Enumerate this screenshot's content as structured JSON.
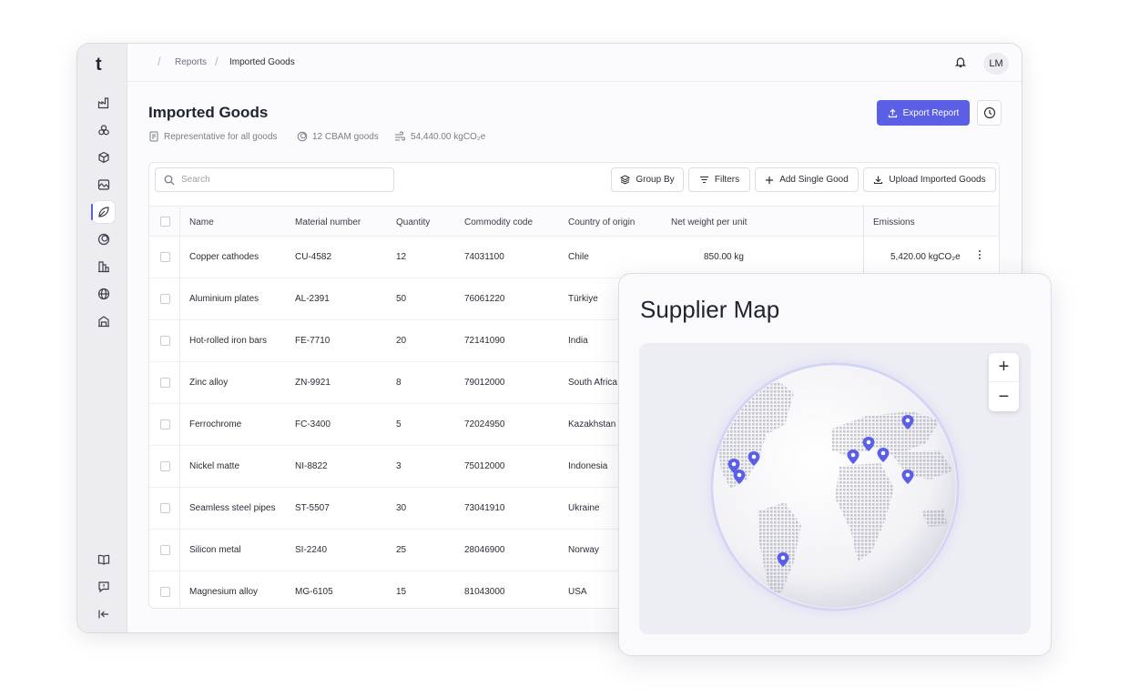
{
  "app": {
    "logo": "t"
  },
  "sidebar": {
    "items": [
      {
        "icon": "factory-icon"
      },
      {
        "icon": "circles-icon"
      },
      {
        "icon": "cube-icon"
      },
      {
        "icon": "image-icon"
      },
      {
        "icon": "leaf-icon",
        "active": true
      },
      {
        "icon": "cycle-icon"
      },
      {
        "icon": "buildings-icon"
      },
      {
        "icon": "globe-icon"
      },
      {
        "icon": "warehouse-icon"
      }
    ],
    "bottom": [
      {
        "icon": "book-icon"
      },
      {
        "icon": "feedback-icon"
      },
      {
        "icon": "collapse-icon"
      }
    ]
  },
  "topbar": {
    "breadcrumb": [
      "Reports",
      "Imported Goods"
    ],
    "avatar": "LM"
  },
  "page": {
    "title": "Imported Goods",
    "meta": {
      "scope": "Representative for all goods",
      "goods": "12 CBAM goods",
      "emissions": "54,440.00 kgCO₂e"
    },
    "export_label": "Export Report"
  },
  "toolbar": {
    "search_placeholder": "Search",
    "group_by": "Group By",
    "filters": "Filters",
    "add_single": "Add Single Good",
    "upload": "Upload Imported Goods"
  },
  "table": {
    "headers": {
      "name": "Name",
      "material": "Material number",
      "quantity": "Quantity",
      "commodity": "Commodity code",
      "country": "Country of origin",
      "weight": "Net weight per unit",
      "emissions": "Emissions"
    },
    "rows": [
      {
        "name": "Copper cathodes",
        "material": "CU-4582",
        "quantity": "12",
        "commodity": "74031100",
        "country": "Chile",
        "weight": "850.00 kg",
        "emissions": "5,420.00 kgCO₂e"
      },
      {
        "name": "Aluminium plates",
        "material": "AL-2391",
        "quantity": "50",
        "commodity": "76061220",
        "country": "Türkiye"
      },
      {
        "name": "Hot-rolled iron bars",
        "material": "FE-7710",
        "quantity": "20",
        "commodity": "72141090",
        "country": "India"
      },
      {
        "name": "Zinc alloy",
        "material": "ZN-9921",
        "quantity": "8",
        "commodity": "79012000",
        "country": "South Africa"
      },
      {
        "name": "Ferrochrome",
        "material": "FC-3400",
        "quantity": "5",
        "commodity": "72024950",
        "country": "Kazakhstan"
      },
      {
        "name": "Nickel matte",
        "material": "NI-8822",
        "quantity": "3",
        "commodity": "75012000",
        "country": "Indonesia"
      },
      {
        "name": "Seamless steel pipes",
        "material": "ST-5507",
        "quantity": "30",
        "commodity": "73041910",
        "country": "Ukraine"
      },
      {
        "name": "Silicon metal",
        "material": "SI-2240",
        "quantity": "25",
        "commodity": "28046900",
        "country": "Norway"
      },
      {
        "name": "Magnesium alloy",
        "material": "MG-6105",
        "quantity": "15",
        "commodity": "81043000",
        "country": "USA"
      }
    ]
  },
  "map": {
    "title": "Supplier Map",
    "zoom_in": "+",
    "zoom_out": "−",
    "pin_color": "#5b5fe6"
  }
}
